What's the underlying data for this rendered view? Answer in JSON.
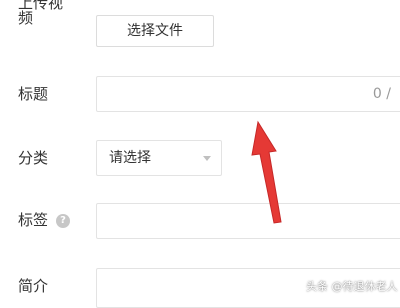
{
  "form": {
    "video": {
      "label_top": "上传视",
      "label_bottom": "频",
      "button_label": "选择文件"
    },
    "title": {
      "label": "标题",
      "counter": "0 /"
    },
    "category": {
      "label": "分类",
      "selected": "请选择"
    },
    "tags": {
      "label": "标签",
      "help_icon_text": "?"
    },
    "intro": {
      "label": "简介"
    }
  },
  "overlay": {
    "watermark": "头条 @待退休老人",
    "arrow_color": "#e53935"
  },
  "icons": {
    "help": "question-circle-icon",
    "dropdown": "caret-down-icon"
  }
}
